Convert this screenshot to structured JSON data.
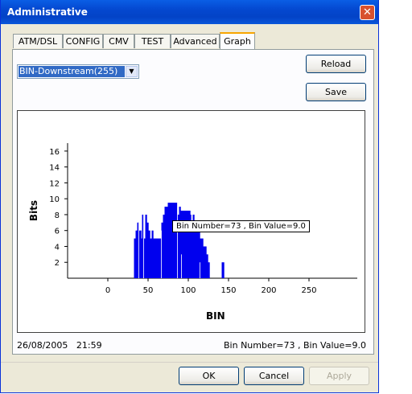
{
  "window": {
    "title": "Administrative",
    "close_glyph": "✕"
  },
  "tabs": [
    {
      "label": "ATM/DSL",
      "active": false
    },
    {
      "label": "CONFIG",
      "active": false
    },
    {
      "label": "CMV",
      "active": false
    },
    {
      "label": "TEST",
      "active": false
    },
    {
      "label": "Advanced",
      "active": false
    },
    {
      "label": "Graph",
      "active": true
    }
  ],
  "selector": {
    "value": "BIN-Downstream(255)",
    "arrow": "▼"
  },
  "buttons": {
    "reload": "Reload",
    "save": "Save",
    "ok": "OK",
    "cancel": "Cancel",
    "apply": "Apply"
  },
  "tooltip": "Bin Number=73 , Bin Value=9.0",
  "status": {
    "date": "26/08/2005",
    "time": "21:59",
    "bin_info": "Bin Number=73 , Bin Value=9.0"
  },
  "chart_data": {
    "type": "bar",
    "ylabel": "Bits",
    "xlabel": "BIN",
    "xlim": [
      -50,
      310
    ],
    "ylim": [
      0,
      17
    ],
    "xticks": [
      0,
      50,
      100,
      150,
      200,
      250
    ],
    "yticks": [
      2,
      4,
      6,
      8,
      10,
      12,
      14,
      16
    ],
    "bar_color": "#0000ee",
    "bins": [
      [
        33,
        5
      ],
      [
        34,
        5
      ],
      [
        35,
        6
      ],
      [
        36,
        6
      ],
      [
        37,
        7
      ],
      [
        38,
        7
      ],
      [
        39,
        6
      ],
      [
        40,
        6
      ],
      [
        41,
        6
      ],
      [
        42,
        5
      ],
      [
        43,
        8
      ],
      [
        44,
        8
      ],
      [
        45,
        5
      ],
      [
        46,
        5
      ],
      [
        47,
        8
      ],
      [
        48,
        8
      ],
      [
        49,
        7
      ],
      [
        50,
        7
      ],
      [
        51,
        6
      ],
      [
        52,
        6
      ],
      [
        53,
        5
      ],
      [
        54,
        5
      ],
      [
        55,
        6
      ],
      [
        56,
        6
      ],
      [
        57,
        5
      ],
      [
        58,
        5
      ],
      [
        59,
        5
      ],
      [
        60,
        5
      ],
      [
        61,
        5
      ],
      [
        62,
        5
      ],
      [
        63,
        5
      ],
      [
        64,
        5
      ],
      [
        65,
        5
      ],
      [
        66,
        5
      ],
      [
        67,
        7
      ],
      [
        68,
        7
      ],
      [
        69,
        8
      ],
      [
        70,
        8
      ],
      [
        71,
        9
      ],
      [
        72,
        9
      ],
      [
        73,
        9
      ],
      [
        74,
        9
      ],
      [
        75,
        9.5
      ],
      [
        76,
        9.5
      ],
      [
        77,
        9.5
      ],
      [
        78,
        9.5
      ],
      [
        79,
        9.5
      ],
      [
        80,
        9.5
      ],
      [
        81,
        9.5
      ],
      [
        82,
        9.5
      ],
      [
        83,
        9.5
      ],
      [
        84,
        9.5
      ],
      [
        85,
        9.5
      ],
      [
        86,
        9.5
      ],
      [
        87,
        8
      ],
      [
        88,
        8
      ],
      [
        89,
        9
      ],
      [
        90,
        9
      ],
      [
        91,
        8.5
      ],
      [
        92,
        8.5
      ],
      [
        93,
        8.5
      ],
      [
        94,
        8.5
      ],
      [
        95,
        8.5
      ],
      [
        96,
        8.5
      ],
      [
        97,
        8.5
      ],
      [
        98,
        8.5
      ],
      [
        99,
        8.5
      ],
      [
        100,
        8.5
      ],
      [
        101,
        8.5
      ],
      [
        102,
        8.5
      ],
      [
        103,
        8
      ],
      [
        104,
        7
      ],
      [
        105,
        7
      ],
      [
        106,
        8
      ],
      [
        107,
        8
      ],
      [
        108,
        7
      ],
      [
        109,
        7
      ],
      [
        110,
        7
      ],
      [
        111,
        6
      ],
      [
        112,
        6
      ],
      [
        113,
        6
      ],
      [
        114,
        6
      ],
      [
        115,
        5
      ],
      [
        116,
        5
      ],
      [
        117,
        5
      ],
      [
        118,
        5
      ],
      [
        119,
        4
      ],
      [
        120,
        4
      ],
      [
        121,
        4
      ],
      [
        122,
        4
      ],
      [
        123,
        3
      ],
      [
        124,
        3
      ],
      [
        125,
        2
      ],
      [
        126,
        2
      ],
      [
        142,
        2
      ],
      [
        143,
        2
      ],
      [
        144,
        2
      ]
    ]
  }
}
